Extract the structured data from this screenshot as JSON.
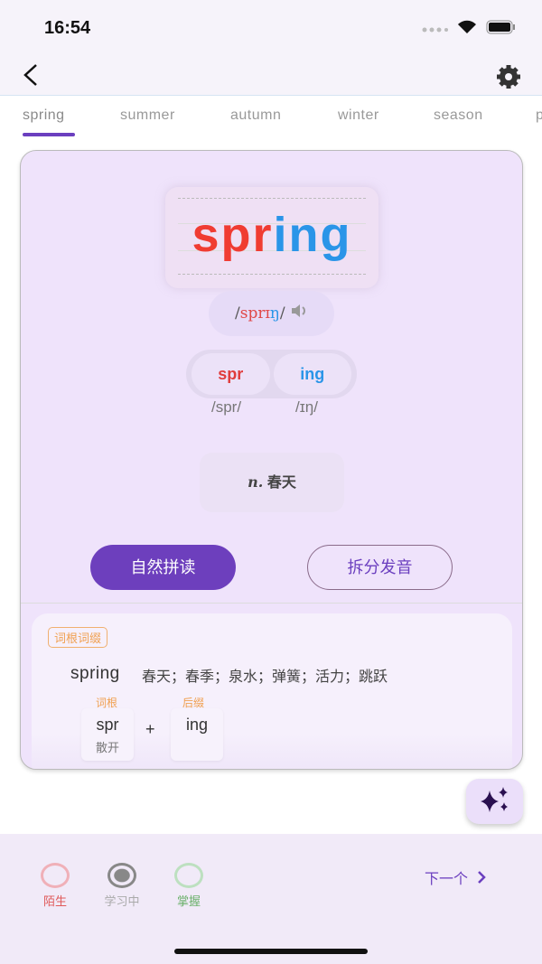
{
  "status_bar": {
    "time": "16:54"
  },
  "tabs": [
    "spring",
    "summer",
    "autumn",
    "winter",
    "season",
    "p"
  ],
  "word": {
    "part1": "spr",
    "part2": "ing",
    "phonetic_open": "/",
    "phonetic_part1": "sprɪ",
    "phonetic_part2": "ŋ",
    "phonetic_close": "/"
  },
  "segments": [
    {
      "text": "spr",
      "phonetic": "/spr/"
    },
    {
      "text": "ing",
      "phonetic": "/ɪŋ/"
    }
  ],
  "meaning": {
    "pos": "n.",
    "text": "春天"
  },
  "buttons": {
    "phonics": "自然拼读",
    "split": "拆分发音"
  },
  "roots": {
    "tag": "词根词缀",
    "word": "spring",
    "definition": "春天；春季；泉水；弹簧；活力；跳跃",
    "parts": [
      {
        "label": "词根",
        "text": "spr",
        "meaning": "散开"
      },
      {
        "label": "后缀",
        "text": "ing",
        "meaning": ""
      }
    ],
    "plus": "+"
  },
  "status_options": [
    {
      "label": "陌生",
      "color": "#e05a5a"
    },
    {
      "label": "学习中",
      "color": "#999999"
    },
    {
      "label": "掌握",
      "color": "#6ab06a"
    }
  ],
  "next": "下一个",
  "colors": {
    "accent": "#6d3fbd",
    "red": "#f03c32",
    "blue": "#2a95e8"
  }
}
